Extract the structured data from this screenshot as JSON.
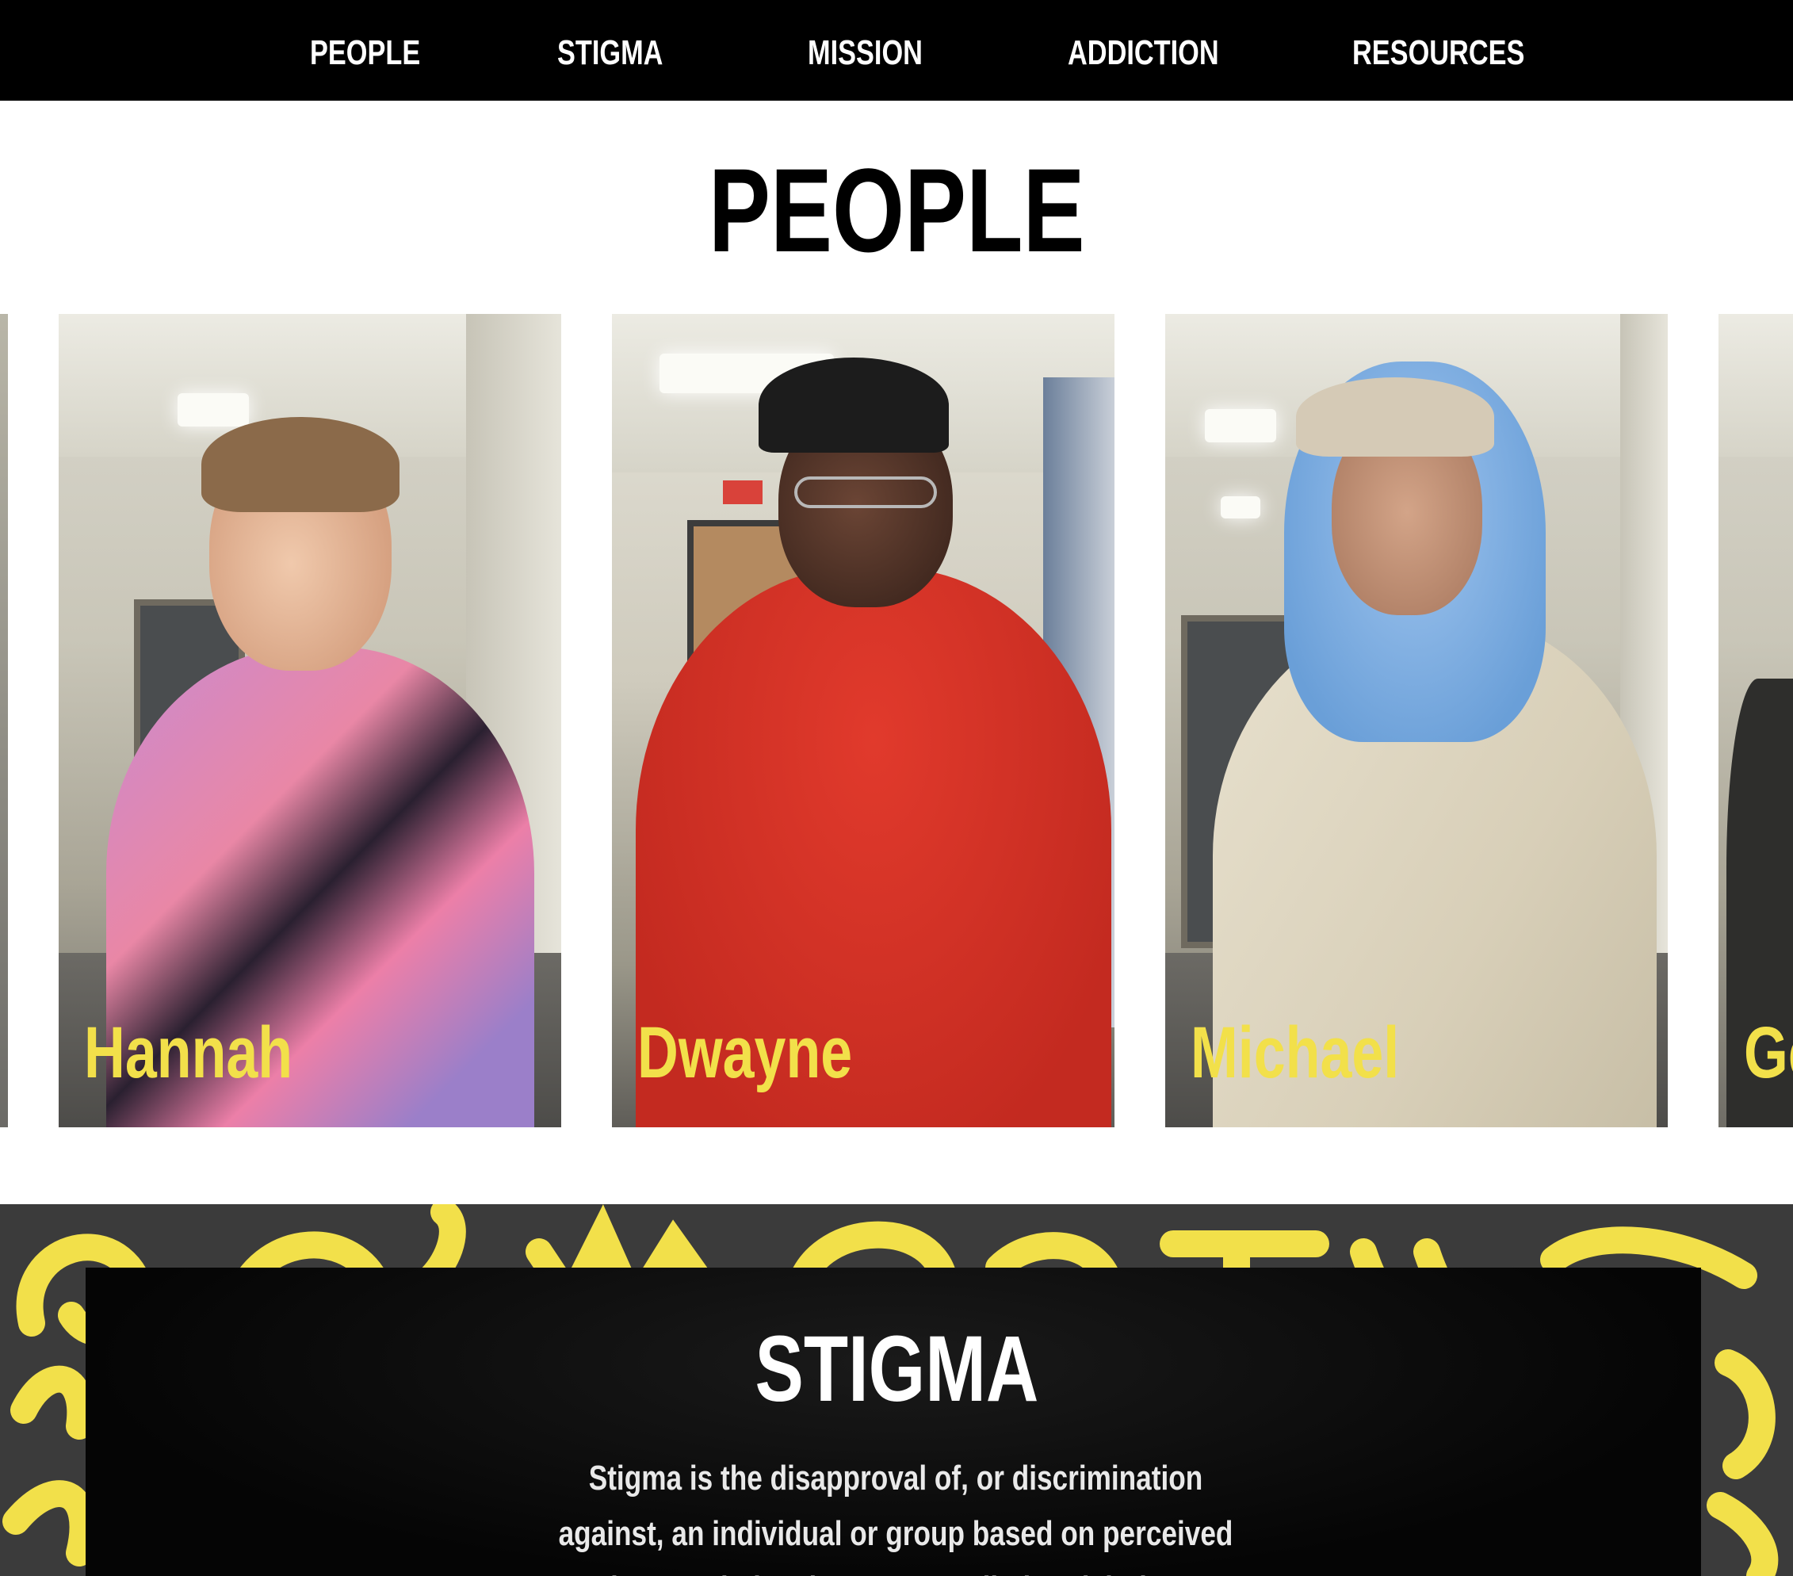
{
  "nav": {
    "items": [
      {
        "label": "PEOPLE"
      },
      {
        "label": "STIGMA"
      },
      {
        "label": "MISSION"
      },
      {
        "label": "ADDICTION"
      },
      {
        "label": "RESOURCES"
      }
    ]
  },
  "people": {
    "title": "PEOPLE",
    "cards": [
      {
        "name": ""
      },
      {
        "name": "Hannah"
      },
      {
        "name": "Dwayne"
      },
      {
        "name": "Michael"
      },
      {
        "name": "Ge"
      }
    ]
  },
  "stigma": {
    "title": "STIGMA",
    "text": "Stigma is the disapproval of, or discrimination against, an individual or group based on perceived characteristics that serve to distinguish them"
  },
  "colors": {
    "accent_yellow": "#f2e04a",
    "nav_bg": "#000000",
    "section_bg": "#3b3b3b"
  }
}
